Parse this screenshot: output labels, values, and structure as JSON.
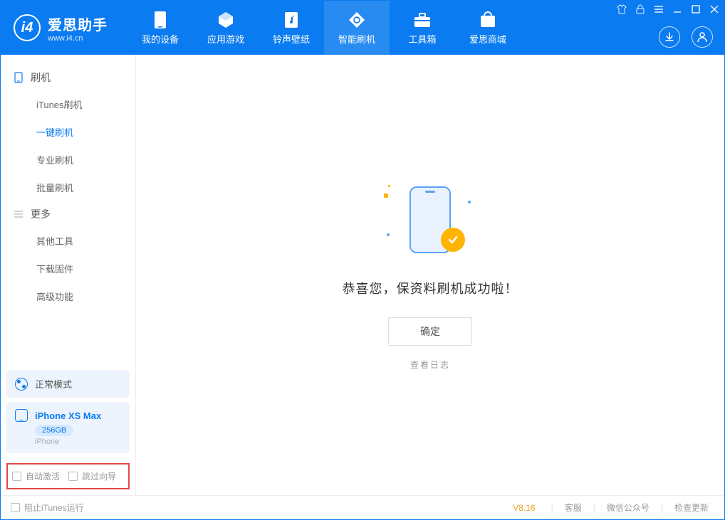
{
  "app": {
    "name": "爱思助手",
    "site": "www.i4.cn"
  },
  "tabs": [
    {
      "label": "我的设备",
      "icon": "device-icon"
    },
    {
      "label": "应用游戏",
      "icon": "cube-icon"
    },
    {
      "label": "铃声壁纸",
      "icon": "music-icon"
    },
    {
      "label": "智能刷机",
      "icon": "refresh-icon"
    },
    {
      "label": "工具箱",
      "icon": "toolbox-icon"
    },
    {
      "label": "爱思商城",
      "icon": "shop-icon"
    }
  ],
  "active_tab_index": 3,
  "sidebar": {
    "groups": [
      {
        "title": "刷机",
        "icon": "phone-icon",
        "items": [
          {
            "label": "iTunes刷机"
          },
          {
            "label": "一键刷机",
            "active": true
          },
          {
            "label": "专业刷机"
          },
          {
            "label": "批量刷机"
          }
        ]
      },
      {
        "title": "更多",
        "icon": "menu-icon",
        "items": [
          {
            "label": "其他工具"
          },
          {
            "label": "下载固件"
          },
          {
            "label": "高级功能"
          }
        ]
      }
    ],
    "mode": "正常模式",
    "device": {
      "name": "iPhone XS Max",
      "capacity": "256GB",
      "type": "iPhone"
    },
    "options": {
      "auto_activate": "自动激活",
      "skip_guide": "跳过向导"
    }
  },
  "main": {
    "success_title": "恭喜您，保资料刷机成功啦！",
    "ok_button": "确定",
    "view_log": "查看日志"
  },
  "footer": {
    "block_itunes": "阻止iTunes运行",
    "version": "V8.16",
    "links": [
      "客服",
      "微信公众号",
      "检查更新"
    ]
  }
}
